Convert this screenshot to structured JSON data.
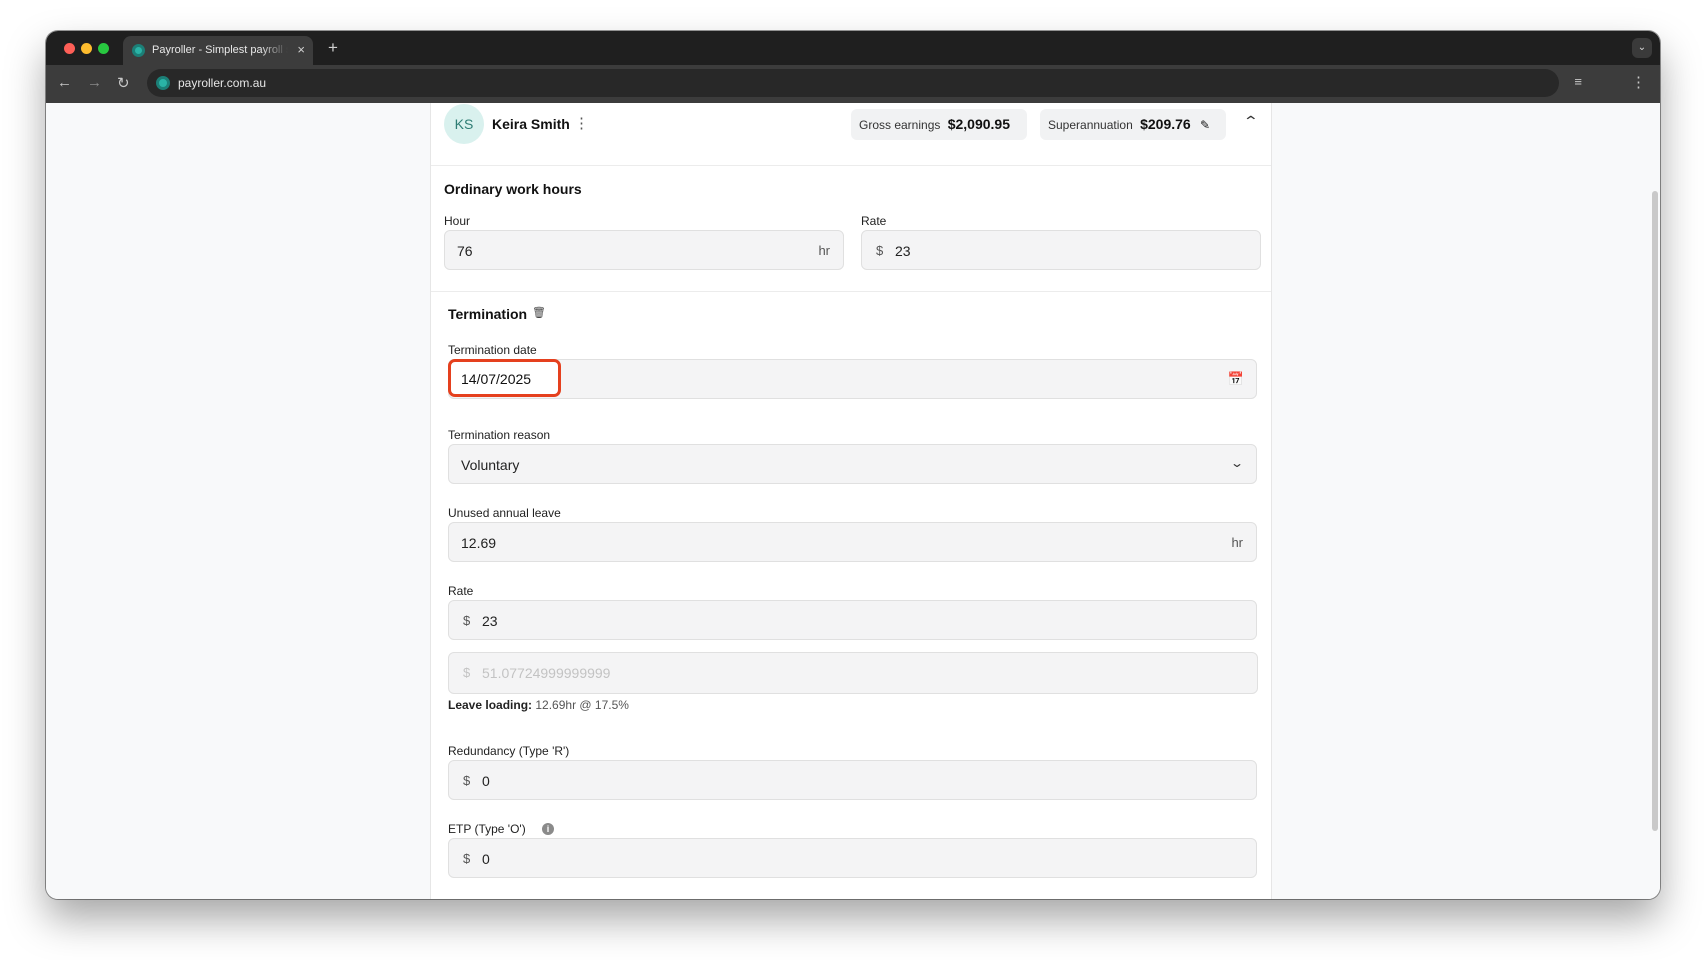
{
  "browser": {
    "tab_title": "Payroller - Simplest payroll software",
    "tab_close": "×",
    "new_tab": "+",
    "url": "payroller.com.au"
  },
  "employee": {
    "initials": "KS",
    "name": "Keira Smith",
    "gross_label": "Gross earnings",
    "gross_value": "$2,090.95",
    "super_label": "Superannuation",
    "super_value": "$209.76"
  },
  "ordinary_hours": {
    "title": "Ordinary work hours",
    "hour_label": "Hour",
    "hour_value": "76",
    "hour_unit": "hr",
    "rate_label": "Rate",
    "rate_prefix": "$",
    "rate_value": "23"
  },
  "termination": {
    "title": "Termination",
    "date_label": "Termination date",
    "date_value": "14/07/2025",
    "reason_label": "Termination reason",
    "reason_value": "Voluntary",
    "unused_leave_label": "Unused annual leave",
    "unused_leave_value": "12.69",
    "unused_leave_unit": "hr",
    "rate_label": "Rate",
    "rate_prefix": "$",
    "rate_value": "23",
    "leave_loading_prefix": "$",
    "leave_loading_amount": "51.07724999999999",
    "leave_loading_label": "Leave loading:",
    "leave_loading_detail": "12.69hr @ 17.5%",
    "redundancy_label": "Redundancy (Type 'R')",
    "redundancy_prefix": "$",
    "redundancy_value": "0",
    "etp_label": "ETP (Type 'O')",
    "etp_prefix": "$",
    "etp_value": "0"
  },
  "colors": {
    "highlight": "#e5401e",
    "accent": "#2ab3a6"
  }
}
